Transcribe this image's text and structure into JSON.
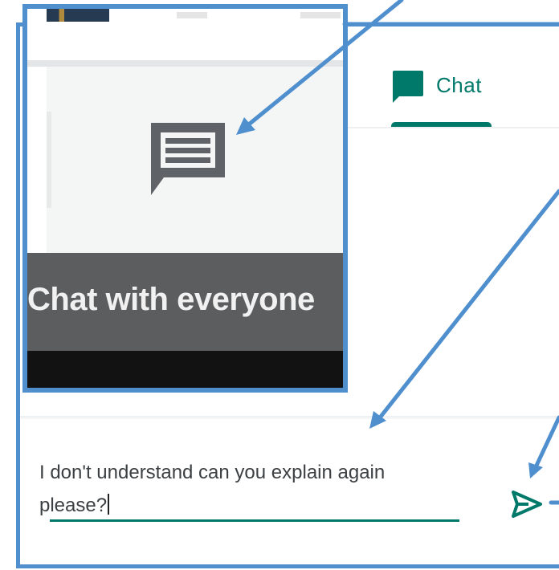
{
  "chat_panel": {
    "tab_label": "Chat",
    "tab_icon": "chat-bubble-icon",
    "message_text": "I don't understand can you explain again please?",
    "send_icon": "send-icon",
    "accent_color": "#00796b"
  },
  "zoom_inset": {
    "caption": "Chat with everyone",
    "icon": "chat-message-icon"
  },
  "annotations": {
    "color": "#4f8fce"
  }
}
